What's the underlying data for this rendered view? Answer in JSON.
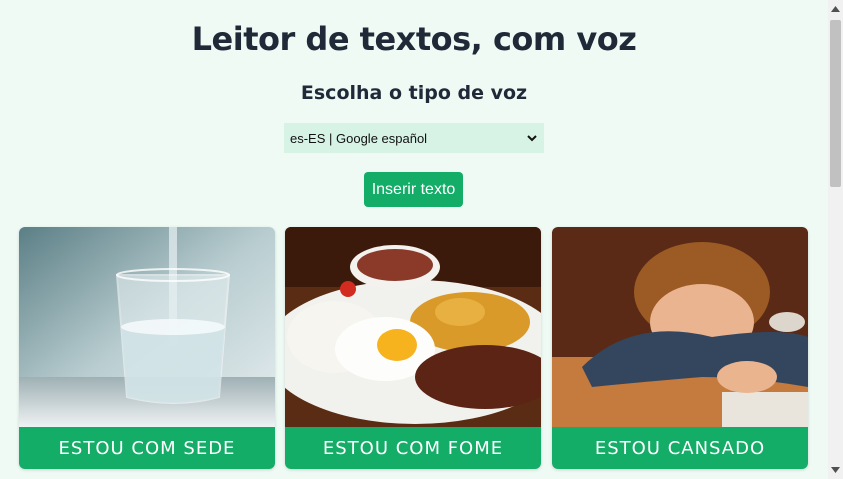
{
  "header": {
    "title": "Leitor de textos, com voz",
    "subtitle": "Escolha o tipo de voz"
  },
  "voice_select": {
    "value": "es-ES | Google español"
  },
  "insert_button": {
    "label": "Inserir texto"
  },
  "cards": [
    {
      "label": "ESTOU COM SEDE",
      "image": "glass-of-water"
    },
    {
      "label": "ESTOU COM FOME",
      "image": "plate-of-food"
    },
    {
      "label": "ESTOU CANSADO",
      "image": "sleeping-child"
    }
  ],
  "colors": {
    "background": "#effaf5",
    "accent": "#13ad67",
    "select_background": "#d6f3e6"
  }
}
